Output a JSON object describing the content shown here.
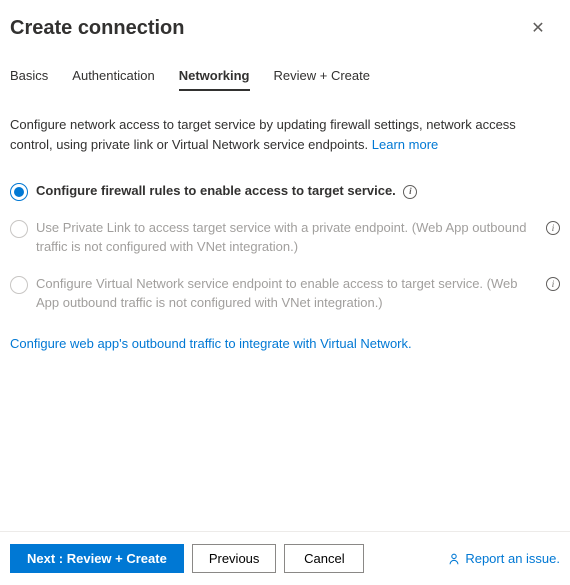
{
  "header": {
    "title": "Create connection"
  },
  "tabs": [
    {
      "label": "Basics",
      "active": false
    },
    {
      "label": "Authentication",
      "active": false
    },
    {
      "label": "Networking",
      "active": true
    },
    {
      "label": "Review + Create",
      "active": false
    }
  ],
  "description": {
    "text": "Configure network access to target service by updating firewall settings, network access control, using private link or Virtual Network service endpoints.",
    "learn_more": "Learn more"
  },
  "options": [
    {
      "label": "Configure firewall rules to enable access to target service.",
      "selected": true,
      "disabled": false,
      "info_inline": true
    },
    {
      "label": "Use Private Link to access target service with a private endpoint. (Web App outbound traffic is not configured with VNet integration.)",
      "selected": false,
      "disabled": true,
      "info_right": true
    },
    {
      "label": "Configure Virtual Network service endpoint to enable access to target service. (Web App outbound traffic is not configured with VNet integration.)",
      "selected": false,
      "disabled": true,
      "info_right": true
    }
  ],
  "configure_link": "Configure web app's outbound traffic to integrate with Virtual Network.",
  "footer": {
    "next": "Next : Review + Create",
    "previous": "Previous",
    "cancel": "Cancel",
    "report": "Report an issue."
  }
}
